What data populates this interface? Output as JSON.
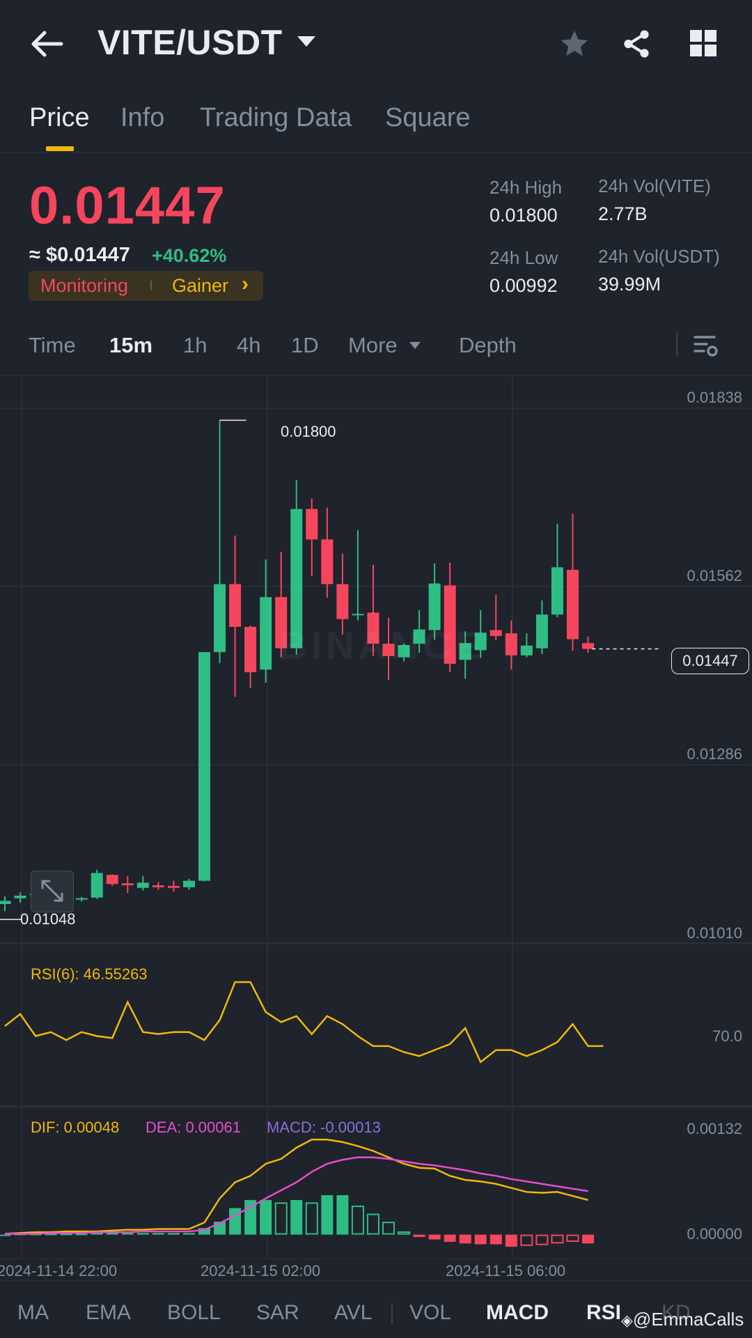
{
  "header": {
    "pair": "VITE/USDT",
    "back_icon": "arrow-left-icon",
    "dropdown_icon": "caret-down-icon",
    "star_icon": "star-icon",
    "share_icon": "share-icon",
    "grid_icon": "grid-icon"
  },
  "tabs": [
    {
      "label": "Price",
      "active": true
    },
    {
      "label": "Info"
    },
    {
      "label": "Trading Data"
    },
    {
      "label": "Square"
    }
  ],
  "price": {
    "last": "0.01447",
    "usd": "≈ $0.01447",
    "change": "+40.62%",
    "tag_left": "Monitoring",
    "tag_right": "Gainer",
    "tag_chevron": "›"
  },
  "stats": {
    "high_label": "24h High",
    "high_value": "0.01800",
    "low_label": "24h Low",
    "low_value": "0.00992",
    "vol_vite_label": "24h Vol(VITE)",
    "vol_vite_value": "2.77B",
    "vol_usdt_label": "24h Vol(USDT)",
    "vol_usdt_value": "39.99M"
  },
  "intervals": {
    "time": "Time",
    "m15": "15m",
    "h1": "1h",
    "h4": "4h",
    "d1": "1D",
    "more": "More",
    "depth": "Depth",
    "settings_icon": "chart-settings-icon"
  },
  "colors": {
    "up": "#2ebd85",
    "down": "#f6465d",
    "accent": "#f0b90b",
    "bg": "#1f232b"
  },
  "chart_data": [
    {
      "type": "candlestick",
      "interval": "15m",
      "ylim": [
        0.0101,
        0.01838
      ],
      "y_ticks": [
        "0.01838",
        "0.01562",
        "0.01286",
        "0.01010"
      ],
      "high_marker": "0.01800",
      "low_marker": "0.01048",
      "current_price_label": "0.01447",
      "watermark": "BINANCE",
      "candles": [
        {
          "o": 0.01053,
          "h": 0.01065,
          "l": 0.01042,
          "c": 0.01058
        },
        {
          "o": 0.01062,
          "h": 0.01071,
          "l": 0.01055,
          "c": 0.01066
        },
        {
          "o": 0.01068,
          "h": 0.01072,
          "l": 0.01065,
          "c": 0.01069
        },
        {
          "o": 0.01061,
          "h": 0.01066,
          "l": 0.01059,
          "c": 0.01063
        },
        {
          "o": 0.01063,
          "h": 0.01068,
          "l": 0.0106,
          "c": 0.01065
        },
        {
          "o": 0.01061,
          "h": 0.01064,
          "l": 0.01057,
          "c": 0.01062
        },
        {
          "o": 0.01063,
          "h": 0.01106,
          "l": 0.01061,
          "c": 0.01101
        },
        {
          "o": 0.01098,
          "h": 0.01099,
          "l": 0.01081,
          "c": 0.01084
        },
        {
          "o": 0.01085,
          "h": 0.01096,
          "l": 0.0107,
          "c": 0.01082
        },
        {
          "o": 0.01078,
          "h": 0.01096,
          "l": 0.01074,
          "c": 0.01086
        },
        {
          "o": 0.01082,
          "h": 0.01087,
          "l": 0.01075,
          "c": 0.01079
        },
        {
          "o": 0.01081,
          "h": 0.01089,
          "l": 0.01072,
          "c": 0.01078
        },
        {
          "o": 0.01079,
          "h": 0.01092,
          "l": 0.01075,
          "c": 0.01089
        },
        {
          "o": 0.01089,
          "h": 0.01442,
          "l": 0.01088,
          "c": 0.01442
        },
        {
          "o": 0.01442,
          "h": 0.018,
          "l": 0.01425,
          "c": 0.01547
        },
        {
          "o": 0.01547,
          "h": 0.01622,
          "l": 0.01373,
          "c": 0.01481
        },
        {
          "o": 0.01481,
          "h": 0.01483,
          "l": 0.01387,
          "c": 0.01411
        },
        {
          "o": 0.01415,
          "h": 0.01585,
          "l": 0.01395,
          "c": 0.01527
        },
        {
          "o": 0.01527,
          "h": 0.01597,
          "l": 0.01434,
          "c": 0.01448
        },
        {
          "o": 0.01448,
          "h": 0.01708,
          "l": 0.01438,
          "c": 0.01663
        },
        {
          "o": 0.01663,
          "h": 0.01679,
          "l": 0.01559,
          "c": 0.01616
        },
        {
          "o": 0.01616,
          "h": 0.01665,
          "l": 0.01526,
          "c": 0.01547
        },
        {
          "o": 0.01547,
          "h": 0.01594,
          "l": 0.01469,
          "c": 0.01493
        },
        {
          "o": 0.01499,
          "h": 0.0163,
          "l": 0.01491,
          "c": 0.01501
        },
        {
          "o": 0.01503,
          "h": 0.01577,
          "l": 0.01436,
          "c": 0.01455
        },
        {
          "o": 0.01455,
          "h": 0.01495,
          "l": 0.01399,
          "c": 0.01436
        },
        {
          "o": 0.01434,
          "h": 0.01455,
          "l": 0.01428,
          "c": 0.01453
        },
        {
          "o": 0.01455,
          "h": 0.01507,
          "l": 0.01441,
          "c": 0.01477
        },
        {
          "o": 0.01476,
          "h": 0.01579,
          "l": 0.01461,
          "c": 0.01548
        },
        {
          "o": 0.01545,
          "h": 0.0158,
          "l": 0.01411,
          "c": 0.01424
        },
        {
          "o": 0.0143,
          "h": 0.01474,
          "l": 0.01401,
          "c": 0.01456
        },
        {
          "o": 0.01445,
          "h": 0.01507,
          "l": 0.01433,
          "c": 0.01472
        },
        {
          "o": 0.01476,
          "h": 0.0153,
          "l": 0.0146,
          "c": 0.01467
        },
        {
          "o": 0.01471,
          "h": 0.01491,
          "l": 0.01415,
          "c": 0.01437
        },
        {
          "o": 0.01437,
          "h": 0.01471,
          "l": 0.01434,
          "c": 0.01452
        },
        {
          "o": 0.01448,
          "h": 0.01522,
          "l": 0.01439,
          "c": 0.015
        },
        {
          "o": 0.015,
          "h": 0.0164,
          "l": 0.01496,
          "c": 0.01573
        },
        {
          "o": 0.01569,
          "h": 0.01656,
          "l": 0.01444,
          "c": 0.01462
        },
        {
          "o": 0.01456,
          "h": 0.01466,
          "l": 0.01441,
          "c": 0.01447
        }
      ]
    },
    {
      "type": "line",
      "indicator": "RSI",
      "label": "RSI(6): 46.55263",
      "level_label": "70.0",
      "ylim": [
        35,
        97
      ],
      "values": [
        75,
        81,
        70,
        72,
        68,
        72,
        70,
        69,
        87,
        72,
        71,
        72,
        72,
        68,
        78,
        97,
        97,
        82,
        77,
        80,
        71,
        80,
        76,
        70,
        65,
        65,
        62,
        60,
        63,
        66,
        74,
        57,
        63,
        63,
        60,
        63,
        67,
        76,
        65,
        65
      ]
    },
    {
      "type": "bar+line",
      "indicator": "MACD",
      "dif_label": "DIF: 0.00048",
      "dea_label": "DEA: 0.00061",
      "macd_label": "MACD: -0.00013",
      "y_ticks": [
        "0.00132",
        "0.00000"
      ],
      "x_labels": [
        "2024-11-14 22:00",
        "2024-11-15 02:00",
        "2024-11-15 06:00"
      ],
      "ylim": [
        -0.00022,
        0.00132
      ],
      "dif": [
        1e-05,
        2e-05,
        3e-05,
        3e-05,
        4e-05,
        4e-05,
        4e-05,
        5e-05,
        6e-05,
        6e-05,
        7e-05,
        7e-05,
        7e-05,
        0.00015,
        0.00045,
        0.00065,
        0.00073,
        0.00088,
        0.00094,
        0.00108,
        0.00118,
        0.00118,
        0.00115,
        0.0011,
        0.00104,
        0.00096,
        0.00088,
        0.00083,
        0.00082,
        0.00073,
        0.00068,
        0.00066,
        0.00063,
        0.00058,
        0.00053,
        0.00052,
        0.00053,
        0.00048,
        0.00043
      ],
      "dea": [
        1e-05,
        1e-05,
        1e-05,
        2e-05,
        2e-05,
        2e-05,
        3e-05,
        3e-05,
        3e-05,
        4e-05,
        4e-05,
        4e-05,
        4e-05,
        6e-05,
        0.00014,
        0.00024,
        0.00034,
        0.00045,
        0.00055,
        0.00065,
        0.00078,
        0.00088,
        0.00093,
        0.00096,
        0.00096,
        0.00094,
        0.00091,
        0.00088,
        0.00086,
        0.00083,
        0.0008,
        0.00076,
        0.00073,
        0.00069,
        0.00066,
        0.00063,
        0.0006,
        0.00057,
        0.00054
      ],
      "hist": [
        0.0,
        1e-05,
        1e-05,
        1e-05,
        1e-05,
        1e-05,
        2e-05,
        2e-05,
        2e-05,
        2e-05,
        2e-05,
        2e-05,
        2e-05,
        8e-05,
        0.00016,
        0.00033,
        0.00043,
        0.00043,
        0.0004,
        0.00043,
        0.0004,
        0.00049,
        0.00049,
        0.00036,
        0.00026,
        0.00016,
        4e-05,
        -3e-05,
        -6e-05,
        -9e-05,
        -0.00011,
        -0.00012,
        -0.00012,
        -0.00015,
        -0.00014,
        -0.00013,
        -0.00011,
        -9e-05,
        -0.00011
      ]
    }
  ],
  "indicators": [
    "MA",
    "EMA",
    "BOLL",
    "SAR",
    "AVL",
    "VOL",
    "MACD",
    "RSI",
    "KD"
  ],
  "watermark_user": "@EmmaCalls"
}
